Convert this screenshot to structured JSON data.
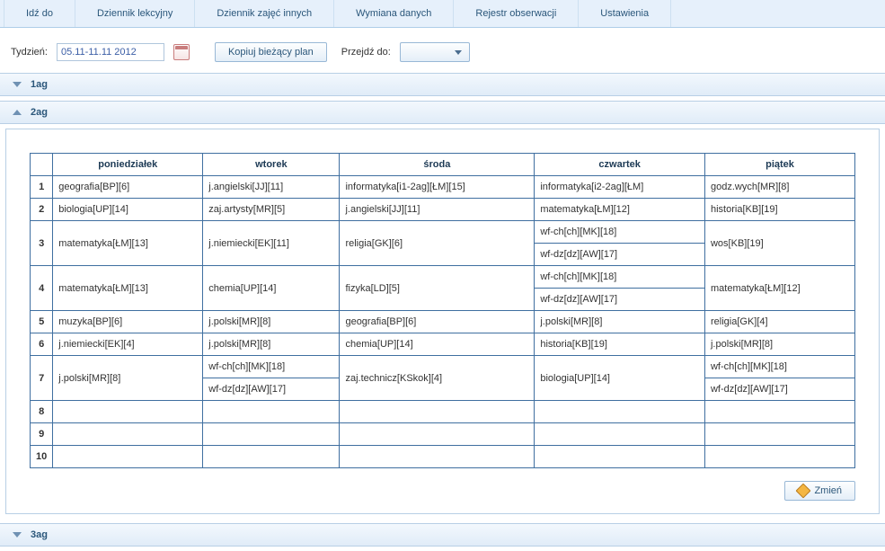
{
  "tabs": {
    "t0": "Idź do",
    "t1": "Dziennik lekcyjny",
    "t2": "Dziennik zajęć innych",
    "t3": "Wymiana danych",
    "t4": "Rejestr obserwacji",
    "t5": "Ustawienia"
  },
  "toolbar": {
    "week_label": "Tydzień:",
    "week_value": "05.11-11.11 2012",
    "copy_label": "Kopiuj bieżący plan",
    "goto_label": "Przejdź do:"
  },
  "sections": {
    "s0": "1ag",
    "s1": "2ag",
    "s2": "3ag"
  },
  "headers": {
    "d0": "poniedziałek",
    "d1": "wtorek",
    "d2": "środa",
    "d3": "czwartek",
    "d4": "piątek"
  },
  "rows": {
    "num": {
      "r1": "1",
      "r2": "2",
      "r3": "3",
      "r4": "4",
      "r5": "5",
      "r6": "6",
      "r7": "7",
      "r8": "8",
      "r9": "9",
      "r10": "10"
    }
  },
  "cells": {
    "r1c0": "geografia[BP][6]",
    "r1c1": "j.angielski[JJ][11]",
    "r1c2": "informatyka[i1-2ag][ŁM][15]",
    "r1c3": "informatyka[i2-2ag][ŁM]",
    "r1c4": "godz.wych[MR][8]",
    "r2c0": "biologia[UP][14]",
    "r2c1": "zaj.artysty[MR][5]",
    "r2c2": "j.angielski[JJ][11]",
    "r2c3": "matematyka[ŁM][12]",
    "r2c4": "historia[KB][19]",
    "r3c0": "matematyka[ŁM][13]",
    "r3c1": "j.niemiecki[EK][11]",
    "r3c2": "religia[GK][6]",
    "r3c3a": "wf-ch[ch][MK][18]",
    "r3c3b": "wf-dz[dz][AW][17]",
    "r3c4": "wos[KB][19]",
    "r4c0": "matematyka[ŁM][13]",
    "r4c1": "chemia[UP][14]",
    "r4c2": "fizyka[LD][5]",
    "r4c3a": "wf-ch[ch][MK][18]",
    "r4c3b": "wf-dz[dz][AW][17]",
    "r4c4": "matematyka[ŁM][12]",
    "r5c0": "muzyka[BP][6]",
    "r5c1": "j.polski[MR][8]",
    "r5c2": "geografia[BP][6]",
    "r5c3": "j.polski[MR][8]",
    "r5c4": "religia[GK][4]",
    "r6c0": "j.niemiecki[EK][4]",
    "r6c1": "j.polski[MR][8]",
    "r6c2": "chemia[UP][14]",
    "r6c3": "historia[KB][19]",
    "r6c4": "j.polski[MR][8]",
    "r7c0": "j.polski[MR][8]",
    "r7c1a": "wf-ch[ch][MK][18]",
    "r7c1b": "wf-dz[dz][AW][17]",
    "r7c2": "zaj.technicz[KSkok][4]",
    "r7c3": "biologia[UP][14]",
    "r7c4a": "wf-ch[ch][MK][18]",
    "r7c4b": "wf-dz[dz][AW][17]"
  },
  "actions": {
    "edit": "Zmień"
  }
}
